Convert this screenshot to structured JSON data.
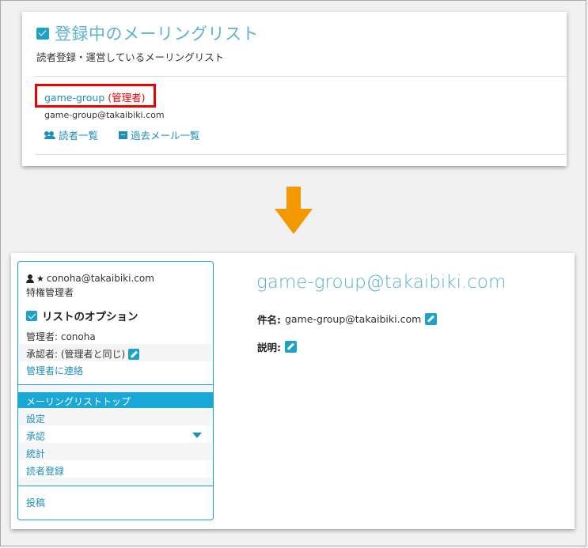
{
  "top": {
    "title": "登録中のメーリングリスト",
    "subtitle": "読者登録・運営しているメーリングリスト",
    "group_name": "game-group",
    "group_role": "(管理者)",
    "group_email": "game-group@takaibiki.com",
    "readers_link": "読者一覧",
    "archive_link": "過去メール一覧"
  },
  "sidebar": {
    "user_email": "conoha@takaibiki.com",
    "user_role": "特権管理者",
    "options_title": "リストのオプション",
    "admin_line": "管理者: conoha",
    "approver_line": "承認者: (管理者と同じ)",
    "contact_link": "管理者に連絡",
    "nav": [
      "メーリングリストトップ",
      "設定",
      "承認",
      "統計",
      "読者登録"
    ],
    "post_link": "投稿"
  },
  "main": {
    "title": "game-group@takaibiki.com",
    "subject_label": "件名:",
    "subject_value": "game-group@takaibiki.com",
    "description_label": "説明:"
  },
  "colors": {
    "accent": "#1ea1c8",
    "link": "#1e8fb8",
    "highlight_border": "#e00000",
    "arrow": "#f39800"
  }
}
